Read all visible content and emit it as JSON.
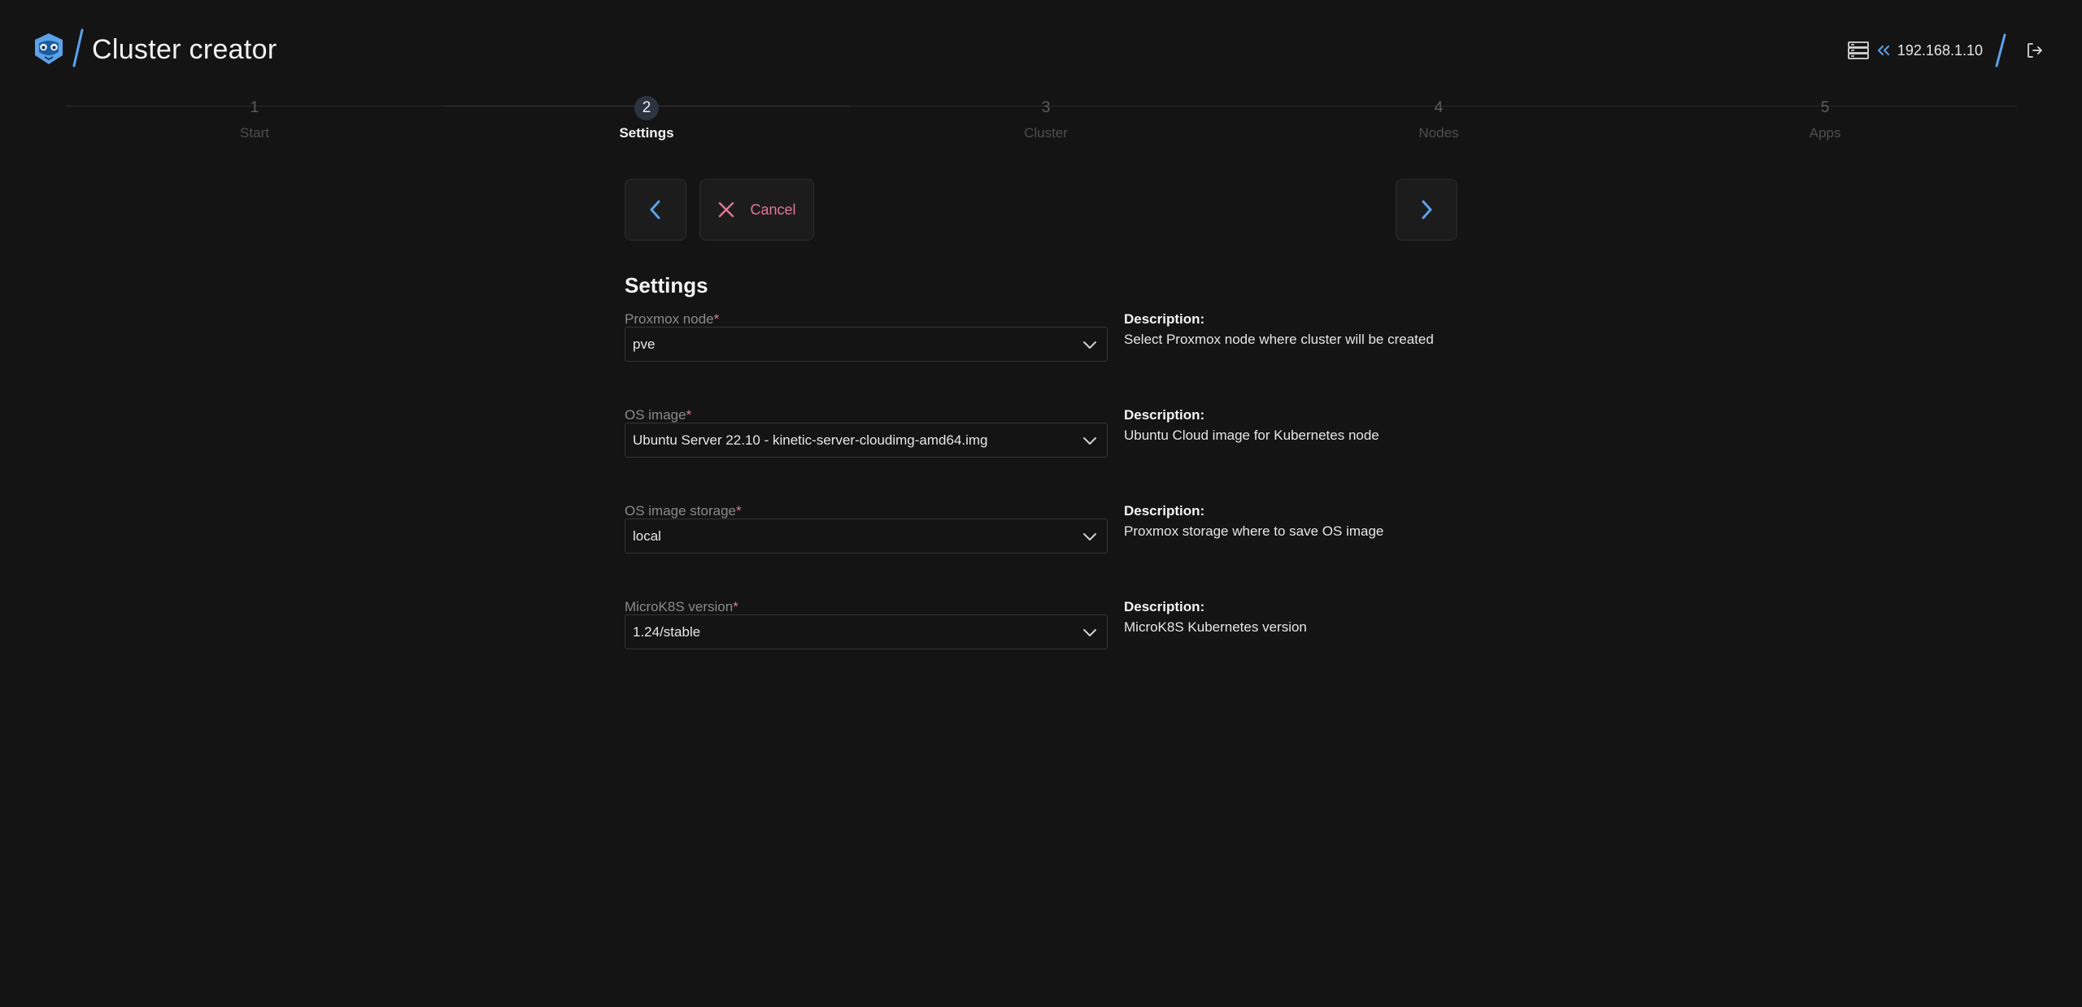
{
  "header": {
    "title": "Cluster creator",
    "host": "192.168.1.10",
    "icons": [
      "logo-icon",
      "server-icon",
      "chevrons-left-icon",
      "logout-icon"
    ],
    "accent": "#5aa2ea"
  },
  "stepper": {
    "steps": [
      {
        "num": "1",
        "label": "Start",
        "active": false
      },
      {
        "num": "2",
        "label": "Settings",
        "active": true
      },
      {
        "num": "3",
        "label": "Cluster",
        "active": false
      },
      {
        "num": "4",
        "label": "Nodes",
        "active": false
      },
      {
        "num": "5",
        "label": "Apps",
        "active": false
      }
    ]
  },
  "nav": {
    "cancel_label": "Cancel",
    "cancel_color": "#e07896"
  },
  "settings": {
    "title": "Settings",
    "fields": [
      {
        "label": "Proxmox node",
        "required": "*",
        "value": "pve",
        "desc_head": "Description:",
        "desc_text": "Select Proxmox node where cluster will be created"
      },
      {
        "label": "OS image",
        "required": "*",
        "value": "Ubuntu Server 22.10 - kinetic-server-cloudimg-amd64.img",
        "desc_head": "Description:",
        "desc_text": "Ubuntu Cloud image for Kubernetes node"
      },
      {
        "label": "OS image storage",
        "required": "*",
        "value": "local",
        "desc_head": "Description:",
        "desc_text": "Proxmox storage where to save OS image"
      },
      {
        "label": "MicroK8S version",
        "required": "*",
        "value": "1.24/stable",
        "desc_head": "Description:",
        "desc_text": "MicroK8S Kubernetes version"
      }
    ]
  }
}
